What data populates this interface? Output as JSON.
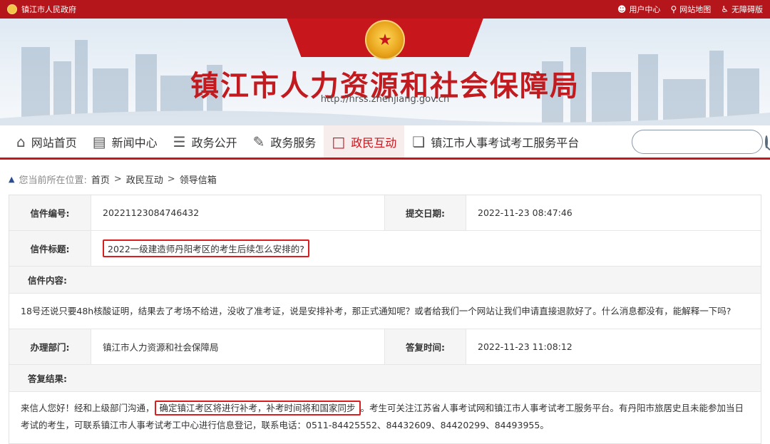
{
  "topbar": {
    "gov_label": "镇江市人民政府",
    "links": [
      {
        "label": "用户中心",
        "icon": "user-icon"
      },
      {
        "label": "网站地图",
        "icon": "location-pin-icon"
      },
      {
        "label": "无障碍版",
        "icon": "accessibility-icon"
      }
    ]
  },
  "banner": {
    "title": "镇江市人力资源和社会保障局",
    "url": "http://hrss.zhenjiang.gov.cn"
  },
  "nav": {
    "items": [
      {
        "label": "网站首页",
        "icon": "home-icon"
      },
      {
        "label": "新闻中心",
        "icon": "news-icon"
      },
      {
        "label": "政务公开",
        "icon": "layers-icon"
      },
      {
        "label": "政务服务",
        "icon": "edit-document-icon"
      },
      {
        "label": "政民互动",
        "icon": "chat-icon"
      },
      {
        "label": "镇江市人事考试考工服务平台",
        "icon": "window-icon"
      }
    ],
    "active_index": 4,
    "search_placeholder": ""
  },
  "breadcrumb": {
    "prefix": "您当前所在位置:",
    "items": [
      "首页",
      "政民互动",
      "领导信箱"
    ],
    "separator": ">"
  },
  "letter": {
    "id_label": "信件编号:",
    "id_value": "20221123084746432",
    "submit_date_label": "提交日期:",
    "submit_date_value": "2022-11-23 08:47:46",
    "subject_label": "信件标题:",
    "subject_value": "2022一级建造师丹阳考区的考生后续怎么安排的?",
    "content_label": "信件内容:",
    "content_value": "18号还说只要48h核酸证明，结果去了考场不给进，没收了准考证，说是安排补考，那正式通知呢？或者给我们一个网站让我们申请直接退款好了。什么消息都没有，能解释一下吗?",
    "dept_label": "办理部门:",
    "dept_value": "镇江市人力资源和社会保障局",
    "reply_time_label": "答复时间:",
    "reply_time_value": "2022-11-23 11:08:12",
    "reply_label": "答复结果:",
    "reply_part1": "来信人您好！经和上级部门沟通，",
    "reply_highlight": "确定镇江考区将进行补考，补考时间将和国家同步",
    "reply_part2": "。考生可关注江苏省人事考试网和镇江市人事考试考工服务平台。有丹阳市旅居史且未能参加当日考试的考生，可联系镇江市人事考试考工中心进行信息登记，联系电话：0511-84425552、84432609、84420299、84493955。"
  },
  "colors": {
    "brand_red": "#c8161d",
    "highlight_border": "#d81e1e"
  }
}
